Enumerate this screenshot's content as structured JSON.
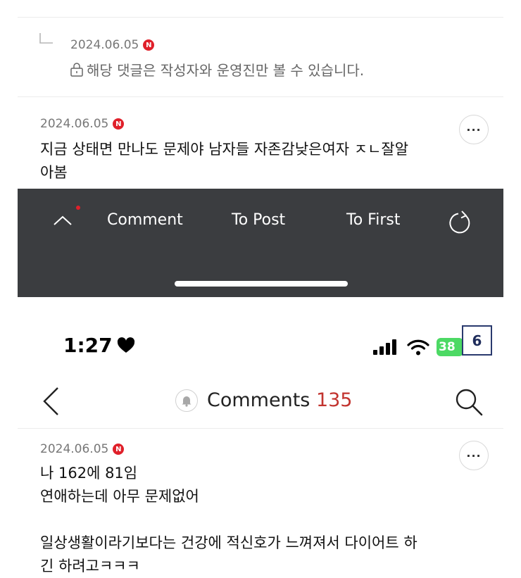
{
  "top_reply": {
    "date": "2024.06.05",
    "badge": "N",
    "text": "해당 댓글은 작성자와 운영진만 볼 수 있습니다."
  },
  "comment_1": {
    "date": "2024.06.05",
    "badge": "N",
    "text_line1": "지금 상태면 만나도 문제야 남자들 자존감낮은여자 ㅈㄴ잘알",
    "text_line2": "아봄",
    "more": "···"
  },
  "bottom_nav": {
    "comment_label": "Comment",
    "to_post_label": "To Post",
    "to_first_label": "To First"
  },
  "status_bar": {
    "time": "1:27",
    "battery": "38",
    "page_badge": "6"
  },
  "header": {
    "title": "Comments",
    "count": "135"
  },
  "comment_2": {
    "date": "2024.06.05",
    "badge": "N",
    "line1": "나 162에 81임",
    "line2": "연애하는데 아무 문제없어",
    "line3": "일상생활이라기보다는 건강에 적신호가 느껴져서 다이어트 하",
    "line4": "긴 하려고ㅋㅋㅋ",
    "more": "···"
  },
  "colors": {
    "accent_red": "#e0202a",
    "count_red": "#c2342f",
    "dark_bar": "#3b3d40",
    "battery_green": "#4cd964"
  }
}
